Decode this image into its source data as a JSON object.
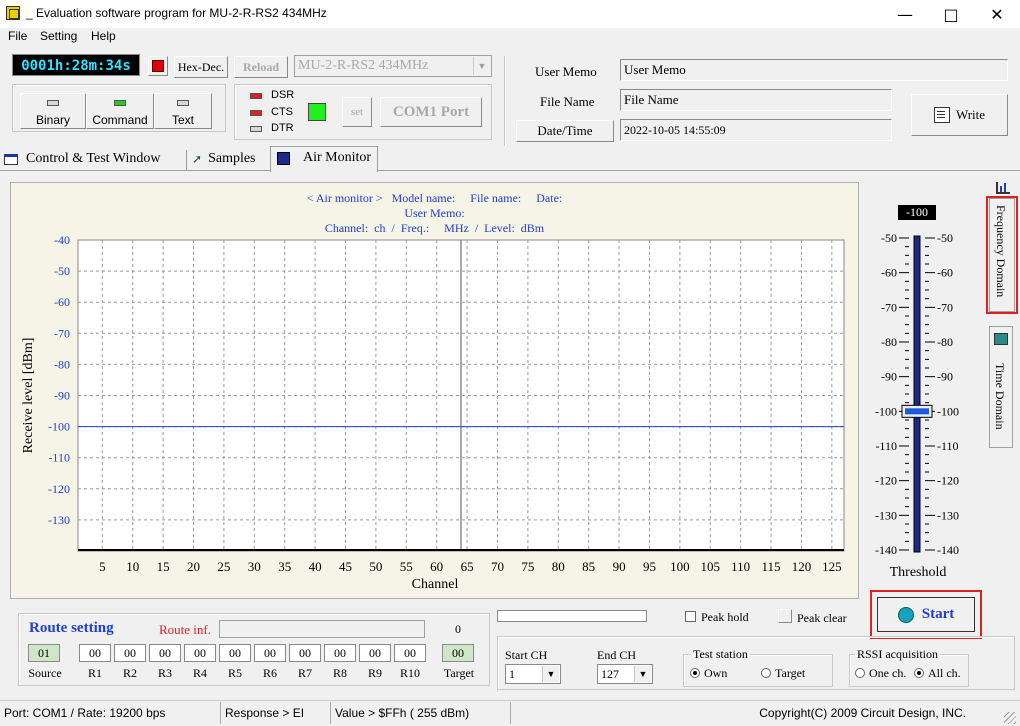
{
  "window": {
    "title": "_ Evaluation software program for MU-2-R-RS2  434MHz"
  },
  "menu": [
    "File",
    "Setting",
    "Help"
  ],
  "toolbar": {
    "timer": "0001h:28m:34s",
    "hexdec": "Hex-Dec.",
    "reload": "Reload",
    "model": "MU-2-R-RS2  434MHz",
    "modes": [
      "Binary",
      "Command",
      "Text"
    ],
    "signals": [
      "DSR",
      "CTS",
      "DTR"
    ],
    "set": "set",
    "com_port": "COM1 Port",
    "colors": {
      "signal_on": "#e02020",
      "signal_off": "#d8d8d8",
      "mode_active": "#22cc22",
      "indicator": "#22ee22"
    }
  },
  "info": {
    "user_memo_label": "User Memo",
    "user_memo_value": "User Memo",
    "file_name_label": "File Name",
    "file_name_value": "File Name",
    "datetime_label": "Date/Time",
    "datetime_value": "2022-10-05 14:55:09",
    "write": "Write"
  },
  "tabs": [
    "Control  & Test Window",
    "Samples",
    "Air Monitor"
  ],
  "side_tabs": [
    "Frequency Domain",
    "Time Domain"
  ],
  "chart_header": {
    "line1": "< Air monitor >   Model name:     File name:     Date:",
    "line2": "User Memo:",
    "line3": "Channel:  ch  /  Freq.:     MHz  /  Level:  dBm"
  },
  "chart_data": {
    "type": "line",
    "title": "",
    "xlabel": "Channel",
    "ylabel": "Receive level [dBm]",
    "xlim": [
      1,
      127
    ],
    "ylim": [
      -140,
      -40
    ],
    "xticks": [
      5,
      10,
      15,
      20,
      25,
      30,
      35,
      40,
      45,
      50,
      55,
      60,
      65,
      70,
      75,
      80,
      85,
      90,
      95,
      100,
      105,
      110,
      115,
      120,
      125
    ],
    "yticks": [
      -40,
      -50,
      -60,
      -70,
      -80,
      -90,
      -100,
      -110,
      -120,
      -130
    ],
    "grid": true,
    "threshold": -100,
    "cursor_channel": 64,
    "series": [
      {
        "x": [
          1,
          127
        ],
        "values": [
          -140,
          -140
        ]
      }
    ],
    "colors": {
      "axis_text": "#1f3fcf",
      "threshold_line": "#1f3fcf",
      "plot_bg": "#ffffff",
      "frame_bg": "#f5f4e6"
    }
  },
  "threshold_slider": {
    "value": "-100",
    "value_num": -100,
    "min": -140,
    "max": -50,
    "ticks": [
      "-50",
      "-60",
      "-70",
      "-80",
      "-90",
      "-100",
      "-110",
      "-120",
      "-130",
      "-140"
    ],
    "label": "Threshold"
  },
  "start_button": "Start",
  "route": {
    "title": "Route setting",
    "inf_label": "Route inf.",
    "count": "0",
    "cells": [
      "01",
      "00",
      "00",
      "00",
      "00",
      "00",
      "00",
      "00",
      "00",
      "00",
      "00",
      "00"
    ],
    "labels": [
      "Source",
      "R1",
      "R2",
      "R3",
      "R4",
      "R5",
      "R6",
      "R7",
      "R8",
      "R9",
      "R10",
      "Target"
    ]
  },
  "controls": {
    "peak_hold": "Peak hold",
    "peak_clear": "Peak clear",
    "start_ch_label": "Start CH",
    "start_ch_value": "1",
    "end_ch_label": "End CH",
    "end_ch_value": "127",
    "test_station": {
      "label": "Test station",
      "options": [
        "Own",
        "Target"
      ],
      "selected": "Own"
    },
    "rssi": {
      "label": "RSSI acquisition",
      "options": [
        "One ch.",
        "All ch."
      ],
      "selected": "All ch."
    }
  },
  "status": {
    "port": "Port: COM1 / Rate: 19200 bps",
    "response": "Response > EI",
    "value": "Value > $FFh ( 255 dBm)",
    "copyright": "Copyright(C) 2009 Circuit Design, INC."
  }
}
